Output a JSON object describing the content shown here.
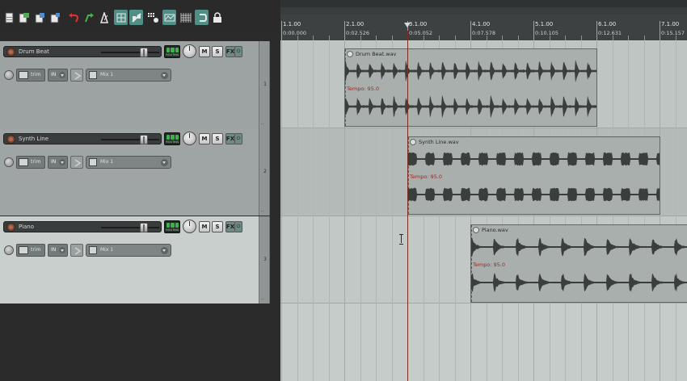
{
  "toolbar": {
    "buttons": [
      {
        "name": "new-project-icon"
      },
      {
        "name": "open-project-icon"
      },
      {
        "name": "save-project-icon"
      },
      {
        "name": "project-settings-icon"
      },
      {
        "name": "undo-icon"
      },
      {
        "name": "redo-icon"
      },
      {
        "name": "metronome-icon"
      },
      {
        "name": "grid-snap-icon",
        "active": true
      },
      {
        "name": "ripple-edit-icon",
        "active": true
      },
      {
        "name": "routing-matrix-icon"
      },
      {
        "name": "envelope-icon",
        "active": true
      },
      {
        "name": "grid-icon"
      },
      {
        "name": "loop-icon",
        "active": true
      },
      {
        "name": "lock-icon"
      }
    ]
  },
  "tracks": [
    {
      "number": "1",
      "name": "Drum Beat",
      "trim_label": "trim",
      "input_label": "IN",
      "mix_label": "Mix 1",
      "mute_label": "M",
      "solo_label": "S",
      "fx_label": "FX",
      "routing_label": "ROUTING"
    },
    {
      "number": "2",
      "name": "Synth Line",
      "trim_label": "trim",
      "input_label": "IN",
      "mix_label": "Mix 1",
      "mute_label": "M",
      "solo_label": "S",
      "fx_label": "FX",
      "routing_label": "ROUTING"
    },
    {
      "number": "3",
      "name": "Piano",
      "trim_label": "trim",
      "input_label": "IN",
      "mix_label": "Mix 1",
      "mute_label": "M",
      "solo_label": "S",
      "fx_label": "FX",
      "routing_label": "ROUTING"
    }
  ],
  "ruler": {
    "marks": [
      {
        "bar": "1.1.00",
        "time": "0:00.000"
      },
      {
        "bar": "2.1.00",
        "time": "0:02.526"
      },
      {
        "bar": "3.1.00",
        "time": "0:05.052"
      },
      {
        "bar": "4.1.00",
        "time": "0:07.578"
      },
      {
        "bar": "5.1.00",
        "time": "0:10.105"
      },
      {
        "bar": "6.1.00",
        "time": "0:12.631"
      },
      {
        "bar": "7.1.00",
        "time": "0:15.157"
      }
    ]
  },
  "items": [
    {
      "name": "Drum Beat.wav",
      "tempo": "Tempo: 95.0"
    },
    {
      "name": "Synth Line.wav",
      "tempo": "Tempo: 95.0"
    },
    {
      "name": "Piano.wav",
      "tempo": "Tempo: 95.0"
    }
  ],
  "colors": {
    "toolbar_active": "#4f8f86",
    "item_bg": "#a9afad",
    "waveform": "#3a3f3e",
    "tempo_text": "#b2201a",
    "playhead": "#7a2b22"
  }
}
